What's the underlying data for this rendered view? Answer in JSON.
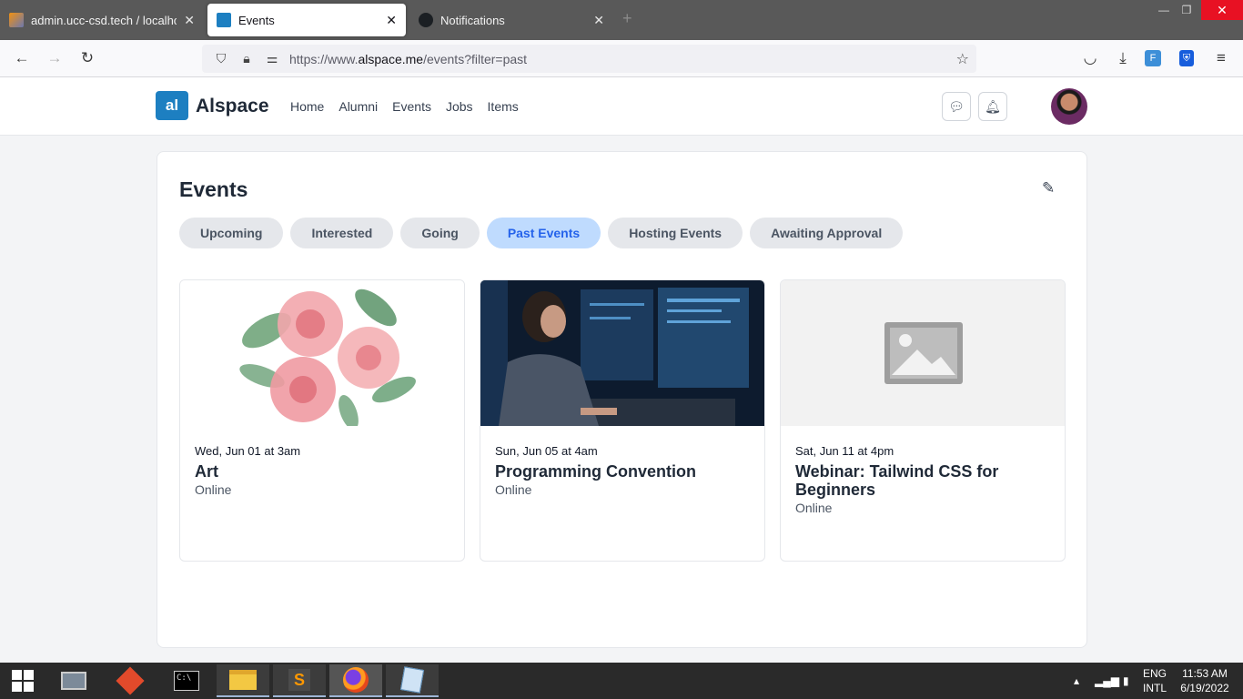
{
  "browser": {
    "tabs": [
      {
        "title": "admin.ucc-csd.tech / localhost",
        "active": false
      },
      {
        "title": "Events",
        "active": true
      },
      {
        "title": "Notifications",
        "active": false
      }
    ],
    "url_prefix": "https://www.",
    "url_host": "alspace.me",
    "url_path": "/events?filter=past"
  },
  "site": {
    "logo_mark": "al",
    "logo_text": "Alspace",
    "nav": [
      "Home",
      "Alumni",
      "Events",
      "Jobs",
      "Items"
    ]
  },
  "page": {
    "title": "Events",
    "tabs": [
      "Upcoming",
      "Interested",
      "Going",
      "Past Events",
      "Hosting Events",
      "Awaiting Approval"
    ],
    "active_tab": "Past Events",
    "events": [
      {
        "date": "Wed, Jun 01 at 3am",
        "name": "Art",
        "location": "Online",
        "image": "watercolor-roses"
      },
      {
        "date": "Sun, Jun 05 at 4am",
        "name": "Programming Convention",
        "location": "Online",
        "image": "programmer-monitors"
      },
      {
        "date": "Sat, Jun 11 at 4pm",
        "name": "Webinar: Tailwind CSS for Beginners",
        "location": "Online",
        "image": "placeholder"
      }
    ]
  },
  "taskbar": {
    "lang_line1": "ENG",
    "lang_line2": "INTL",
    "time": "11:53 AM",
    "date": "6/19/2022"
  },
  "colors": {
    "accent": "#1d7fc1",
    "active_pill_bg": "#bfdbfe",
    "active_pill_text": "#2563eb"
  }
}
